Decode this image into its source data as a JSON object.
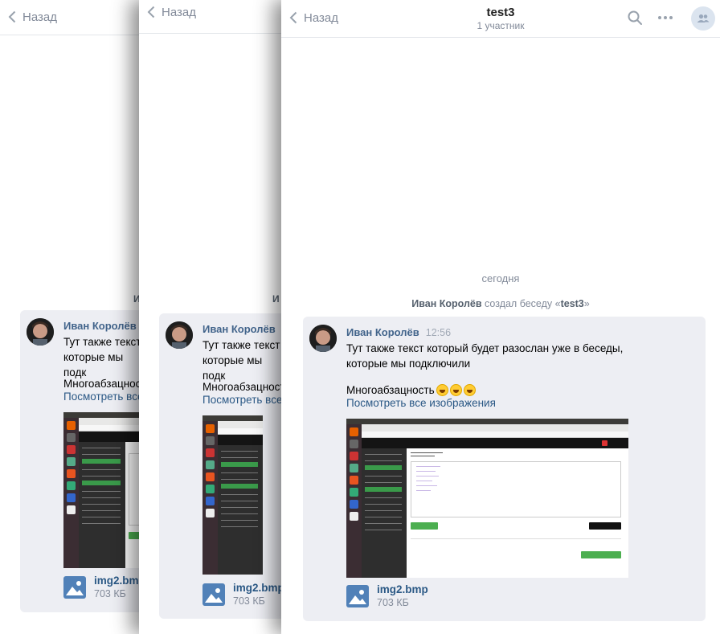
{
  "back_label": "Назад",
  "chat": {
    "title": "test3",
    "participants": "1 участник"
  },
  "icons": {
    "back": "chevron-left-icon",
    "search": "search-icon",
    "more": "more-horizontal-icon",
    "members": "group-members-icon",
    "file": "image-file-icon"
  },
  "date_separator": "сегодня",
  "service_message": {
    "author": "Иван Королёв",
    "text": "создал беседу «",
    "chat_name": "test3",
    "close": "»"
  },
  "message": {
    "author": "Иван Королёв",
    "time": "12:56",
    "text": "Тут также текст который будет разослан уже в беседы, которые мы подключили",
    "paragraph2": "Многоабзацность",
    "view_all": "Посмотреть все изображения"
  },
  "truncated": {
    "line1": "Тут также текст",
    "line2": "которые мы подк",
    "paragraph2": "Многоабзацность",
    "view_all": "Посмотреть все",
    "author": "Иван Королёв",
    "service_fragment": "И"
  },
  "attachment": {
    "name": "img2.bmp",
    "size": "703 КБ"
  },
  "colors": {
    "link": "#2a5885",
    "author": "#42648b",
    "muted": "#828a99",
    "bubble": "#edeef3"
  }
}
